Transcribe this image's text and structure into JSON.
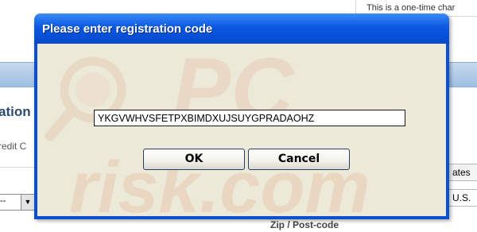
{
  "background_page": {
    "top_right_text": "This is a one-time char",
    "heading_fragment": "ation",
    "sublabel_fragment": "redit C",
    "select_value": "--",
    "state_field_fragment": "ates",
    "country_fragment": "U.S.",
    "zip_label": "Zip / Post-code"
  },
  "dialog": {
    "title": "Please enter registration code",
    "code_value": "YKGVWHVSFETPXBIMDXUJSUYGPRADAOHZ",
    "ok_label": "OK",
    "cancel_label": "Cancel"
  },
  "watermark": {
    "logo_text": "PC",
    "site_text": "risk.com"
  },
  "colors": {
    "title_bar": "#0a58e0",
    "dialog_body": "#ece9d8",
    "background_bar": "#a9c6e6",
    "watermark": "#e6cdb4"
  }
}
